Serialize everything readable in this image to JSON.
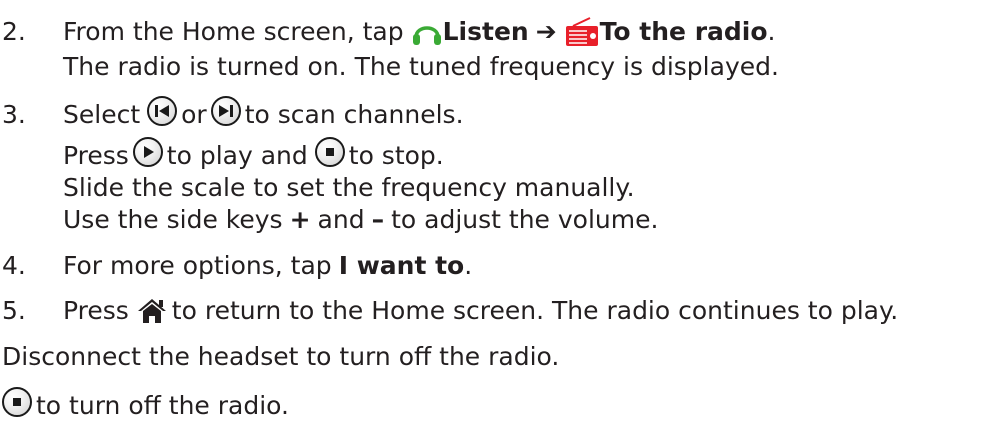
{
  "steps": [
    {
      "number": "2.",
      "text1": "From the Home screen, tap",
      "bold1": "Listen",
      "arrow": "➔",
      "bold2": "To the radio",
      "end": ".",
      "line2": "The radio is turned on. The tuned frequency is displayed."
    },
    {
      "number": "3.",
      "select": "Select",
      "or": "or",
      "scan": "to scan channels.",
      "press": "Press",
      "play": "to play and",
      "stop": "to stop.",
      "slide": "Slide the scale to set the frequency manually.",
      "volume_a": "Use the side keys",
      "plus": "+",
      "and": "and",
      "minus": "–",
      "volume_b": "to adjust the volume."
    },
    {
      "number": "4.",
      "text": "For more options, tap",
      "bold": "I want to",
      "end": "."
    },
    {
      "number": "5.",
      "press": "Press",
      "text": "to return to the Home screen. The radio continues to play."
    }
  ],
  "note_disconnect": "Disconnect the headset to turn off the radio.",
  "note_stop": "to turn off the radio.",
  "icons": {
    "headset": "headset-icon",
    "radio": "radio-icon",
    "previous": "previous-icon",
    "next": "next-icon",
    "play": "play-icon",
    "stop": "stop-icon",
    "home": "home-icon"
  },
  "colors": {
    "text": "#231f20",
    "accent_green": "#3aaa35",
    "accent_red": "#e8202a"
  }
}
